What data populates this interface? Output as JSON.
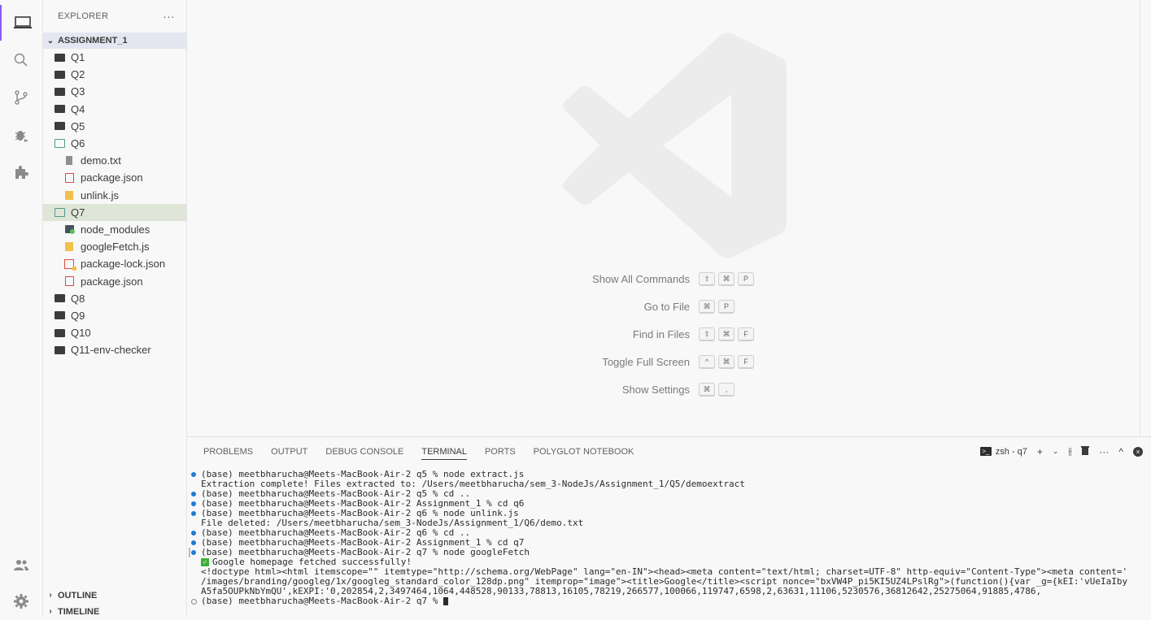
{
  "activity_bar": {
    "items": [
      {
        "name": "explorer-icon",
        "active": true
      },
      {
        "name": "search-icon"
      },
      {
        "name": "source-control-icon"
      },
      {
        "name": "run-debug-icon"
      },
      {
        "name": "extensions-icon"
      }
    ],
    "bottom": [
      {
        "name": "accounts-icon"
      },
      {
        "name": "manage-gear-icon"
      }
    ]
  },
  "sidebar": {
    "title": "EXPLORER",
    "more": "···",
    "root_folder": "ASSIGNMENT_1",
    "items": [
      {
        "label": "Q1",
        "type": "folder"
      },
      {
        "label": "Q2",
        "type": "folder"
      },
      {
        "label": "Q3",
        "type": "folder"
      },
      {
        "label": "Q4",
        "type": "folder"
      },
      {
        "label": "Q5",
        "type": "folder"
      },
      {
        "label": "Q6",
        "type": "folder-open"
      },
      {
        "label": "demo.txt",
        "type": "txt"
      },
      {
        "label": "package.json",
        "type": "json"
      },
      {
        "label": "unlink.js",
        "type": "js"
      },
      {
        "label": "Q7",
        "type": "folder-open"
      },
      {
        "label": "node_modules",
        "type": "node_modules"
      },
      {
        "label": "googleFetch.js",
        "type": "js"
      },
      {
        "label": "package-lock.json",
        "type": "lock"
      },
      {
        "label": "package.json",
        "type": "json"
      },
      {
        "label": "Q8",
        "type": "folder"
      },
      {
        "label": "Q9",
        "type": "folder"
      },
      {
        "label": "Q10",
        "type": "folder"
      },
      {
        "label": "Q11-env-checker",
        "type": "folder"
      }
    ],
    "outline": "OUTLINE",
    "timeline": "TIMELINE"
  },
  "editor": {
    "shortcuts": [
      {
        "label": "Show All Commands",
        "keys": [
          "⇧",
          "⌘",
          "P"
        ]
      },
      {
        "label": "Go to File",
        "keys": [
          "⌘",
          "P"
        ]
      },
      {
        "label": "Find in Files",
        "keys": [
          "⇧",
          "⌘",
          "F"
        ]
      },
      {
        "label": "Toggle Full Screen",
        "keys": [
          "^",
          "⌘",
          "F"
        ]
      },
      {
        "label": "Show Settings",
        "keys": [
          "⌘",
          ","
        ]
      }
    ]
  },
  "panel": {
    "tabs": [
      "PROBLEMS",
      "OUTPUT",
      "DEBUG CONSOLE",
      "TERMINAL",
      "PORTS",
      "POLYGLOT NOTEBOOK"
    ],
    "active_tab": "TERMINAL",
    "shell_label": "zsh - q7",
    "terminal_lines": [
      {
        "text": "(base) meetbharucha@Meets-MacBook-Air-2 q5 % node extract.js",
        "marker": "dot"
      },
      {
        "text": "Extraction complete! Files extracted to: /Users/meetbharucha/sem_3-NodeJs/Assignment_1/Q5/demoextract",
        "marker": "none"
      },
      {
        "text": "(base) meetbharucha@Meets-MacBook-Air-2 q5 % cd ..",
        "marker": "dot"
      },
      {
        "text": "(base) meetbharucha@Meets-MacBook-Air-2 Assignment_1 % cd q6",
        "marker": "dot"
      },
      {
        "text": "(base) meetbharucha@Meets-MacBook-Air-2 q6 % node unlink.js",
        "marker": "dot"
      },
      {
        "text": "File deleted: /Users/meetbharucha/sem_3-NodeJs/Assignment_1/Q6/demo.txt",
        "marker": "none"
      },
      {
        "text": "(base) meetbharucha@Meets-MacBook-Air-2 q6 % cd ..",
        "marker": "dot"
      },
      {
        "text": "(base) meetbharucha@Meets-MacBook-Air-2 Assignment_1 % cd q7",
        "marker": "dot"
      },
      {
        "text": "(base) meetbharucha@Meets-MacBook-Air-2 q7 % node googleFetch",
        "marker": "dot-bar"
      },
      {
        "text": "Google homepage fetched successfully!",
        "marker": "check"
      },
      {
        "text": "<!doctype html><html itemscope=\"\" itemtype=\"http://schema.org/WebPage\" lang=\"en-IN\"><head><meta content=\"text/html; charset=UTF-8\" http-equiv=\"Content-Type\"><meta content='",
        "marker": "none"
      },
      {
        "text": "/images/branding/googleg/1x/googleg_standard_color_128dp.png\" itemprop=\"image\"><title>Google</title><script nonce=\"bxVW4P_pi5KI5UZ4LPslRg\">(function(){var _g={kEI:'vUeIaIby",
        "marker": "none"
      },
      {
        "text": "A5fa5OUPkNbYmQU',kEXPI:'0,202854,2,3497464,1064,448528,90133,78813,16105,78219,266577,100066,119747,6598,2,63631,11106,5230576,36812642,25275064,91885,4786,",
        "marker": "none"
      },
      {
        "text": "(base) meetbharucha@Meets-MacBook-Air-2 q7 % ",
        "marker": "hollow-cursor"
      }
    ]
  },
  "colors": {
    "accent": "#8b5cf6",
    "dot": "#1f7bd4",
    "selected": "#dfe6d8"
  }
}
